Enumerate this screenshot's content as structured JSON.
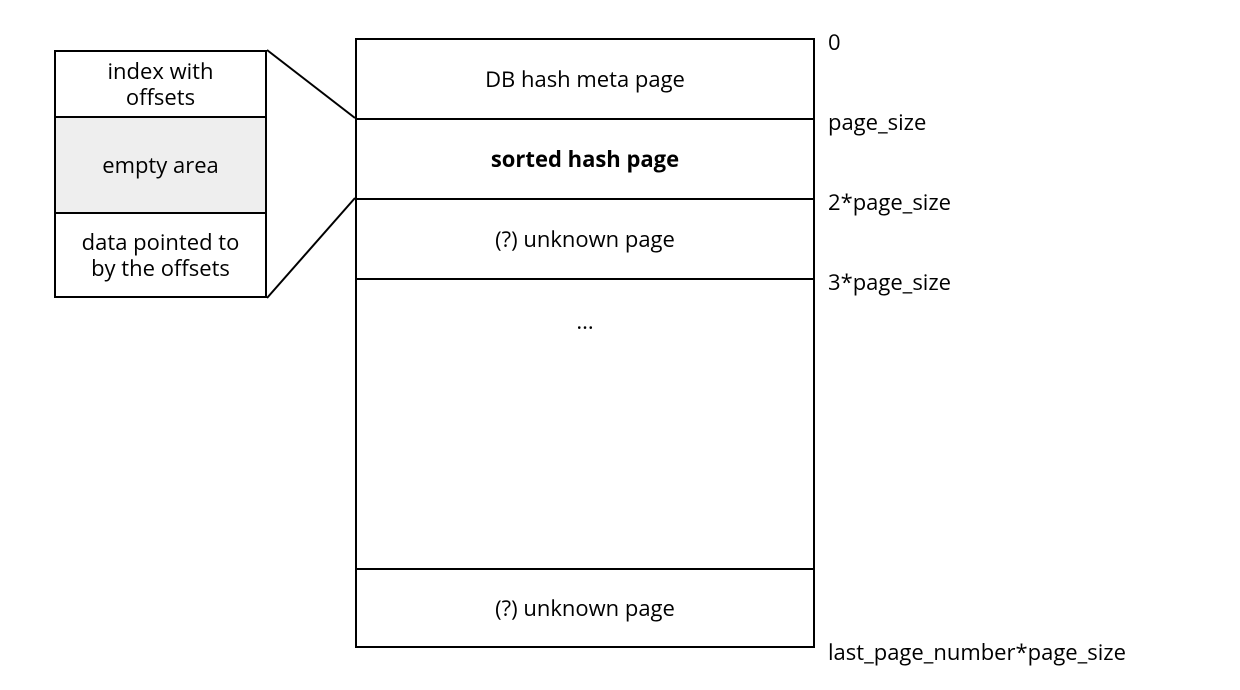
{
  "detail": {
    "index": "index with\noffsets",
    "empty": "empty area",
    "data": "data pointed to\nby the offsets"
  },
  "pages": {
    "meta": "DB hash meta page",
    "sorted": "sorted hash page",
    "unknown1": "(?) unknown page",
    "ellipsis": "...",
    "unknown2": "(?) unknown page"
  },
  "offsets": {
    "o0": "0",
    "o1": "page_size",
    "o2": "2*page_size",
    "o3": "3*page_size",
    "olast": "last_page_number*page_size"
  },
  "chart_data": {
    "type": "diagram",
    "description": "Layout of a hashed DB file as a sequence of fixed-size pages, with the second page (sorted hash page) expanded to show its internal structure.",
    "page_sequence": [
      {
        "index": 0,
        "offset": "0",
        "label": "DB hash meta page"
      },
      {
        "index": 1,
        "offset": "page_size",
        "label": "sorted hash page",
        "highlighted": true
      },
      {
        "index": 2,
        "offset": "2*page_size",
        "label": "(?) unknown page"
      },
      {
        "index": 3,
        "offset": "3*page_size",
        "label": "..."
      },
      {
        "index": "last_page_number",
        "offset": "last_page_number*page_size",
        "label": "(?) unknown page"
      }
    ],
    "sorted_hash_page_layout": [
      "index with offsets",
      "empty area",
      "data pointed to by the offsets"
    ]
  }
}
